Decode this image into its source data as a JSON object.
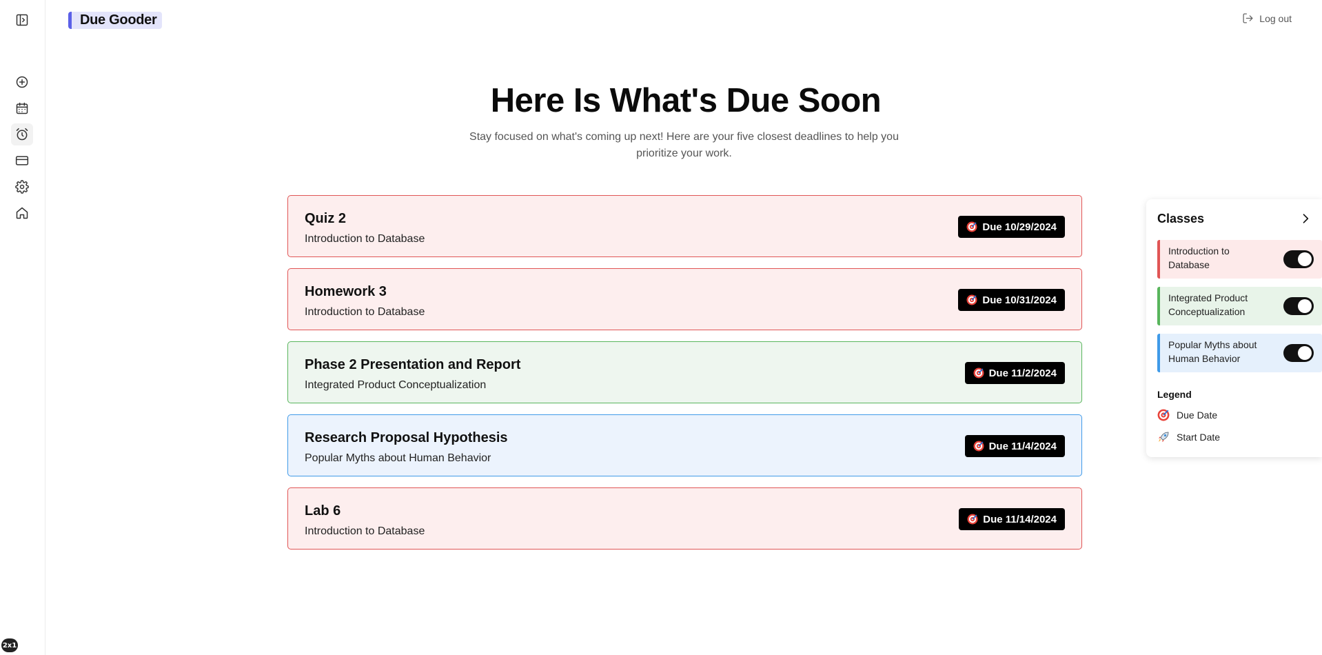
{
  "app": {
    "brand": "Due Gooder",
    "logout_label": "Log out",
    "corner_badge": "2x1"
  },
  "sidebar": {
    "items": [
      {
        "icon": "panel-toggle-icon"
      },
      {
        "icon": "plus-circle-icon"
      },
      {
        "icon": "calendar-icon"
      },
      {
        "icon": "alarm-clock-icon",
        "active": true
      },
      {
        "icon": "credit-card-icon"
      },
      {
        "icon": "gear-icon"
      },
      {
        "icon": "home-icon"
      }
    ]
  },
  "hero": {
    "title": "Here Is What's Due Soon",
    "subtitle": "Stay focused on what's coming up next! Here are your five closest deadlines to help you prioritize your work."
  },
  "assignments": [
    {
      "title": "Quiz 2",
      "class": "Introduction to Database",
      "due": "Due 10/29/2024",
      "color": "#e05555"
    },
    {
      "title": "Homework 3",
      "class": "Introduction to Database",
      "due": "Due 10/31/2024",
      "color": "#e05555"
    },
    {
      "title": "Phase 2 Presentation and Report",
      "class": "Integrated Product Conceptualization",
      "due": "Due 11/2/2024",
      "color": "#58b55c"
    },
    {
      "title": "Research Proposal Hypothesis",
      "class": "Popular Myths about Human Behavior",
      "due": "Due 11/4/2024",
      "color": "#3f9ae8"
    },
    {
      "title": "Lab 6",
      "class": "Introduction to Database",
      "due": "Due 11/14/2024",
      "color": "#e05555"
    }
  ],
  "classes_panel": {
    "title": "Classes",
    "classes": [
      {
        "name": "Introduction to Database",
        "color": "#e05555",
        "enabled": true
      },
      {
        "name": "Integrated Product Conceptualization",
        "color": "#58b55c",
        "enabled": true
      },
      {
        "name": "Popular Myths about Human Behavior",
        "color": "#3f9ae8",
        "enabled": true
      }
    ],
    "legend": {
      "title": "Legend",
      "items": [
        {
          "icon": "target-icon",
          "label": "Due Date"
        },
        {
          "icon": "rocket-icon",
          "label": "Start Date"
        }
      ]
    }
  }
}
